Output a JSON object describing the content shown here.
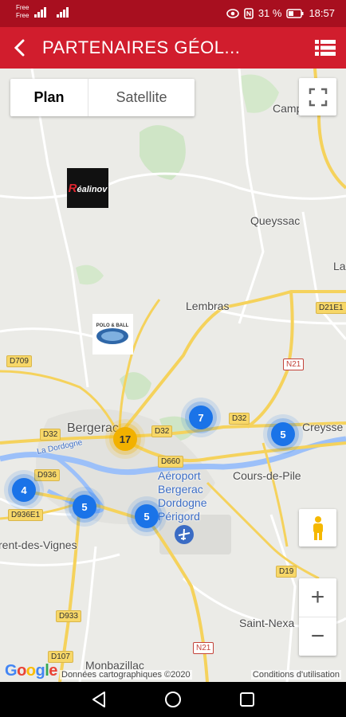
{
  "status_bar": {
    "carrier_1": "Free",
    "carrier_2": "Free",
    "battery": "31 %",
    "time": "18:57"
  },
  "app_bar": {
    "title": "PARTENAIRES GÉOL...",
    "back_icon": "back-arrow-icon",
    "list_icon": "list-view-icon"
  },
  "map": {
    "map_type": {
      "plan": "Plan",
      "satellite": "Satellite",
      "selected": "Plan"
    },
    "places": {
      "camp": "Camp",
      "queyssac": "Queyssac",
      "la": "La",
      "lembras": "Lembras",
      "bergerac": "Bergerac",
      "creysse": "Creysse",
      "cours_de_pile": "Cours-de-Pile",
      "la_dordogne": "La Dordogne",
      "aeroport": "Aéroport",
      "bergerac2": "Bergerac",
      "dordogne": "Dordogne",
      "perigord": "Périgord",
      "vignes": "rent-des-Vignes",
      "saint_nexans": "Saint-Nexa",
      "monbazillac": "Monbazillac"
    },
    "roads": {
      "d709": "D709",
      "d32a": "D32",
      "d32b": "D32",
      "d32c": "D32",
      "d936": "D936",
      "d936e1": "D936E1",
      "d660": "D660",
      "n21a": "N21",
      "n21b": "N21",
      "d21e1": "D21E1",
      "d19": "D19",
      "d933": "D933",
      "d107": "D107"
    },
    "partners": {
      "realinov": "Réalinov",
      "polo": "POLO & BALL"
    },
    "clusters": {
      "c17": "17",
      "c7": "7",
      "c5_creysse": "5",
      "c4": "4",
      "c5_a": "5",
      "c5_b": "5"
    },
    "attribution": {
      "google": "Google",
      "data": "Données cartographiques ©2020",
      "terms": "Conditions d'utilisation"
    },
    "zoom_in": "+",
    "zoom_out": "−"
  },
  "colors": {
    "status_bar": "#a80f1f",
    "app_bar": "#d11d2d",
    "cluster_blue": "#1a73e8",
    "cluster_orange": "#f2b100"
  }
}
